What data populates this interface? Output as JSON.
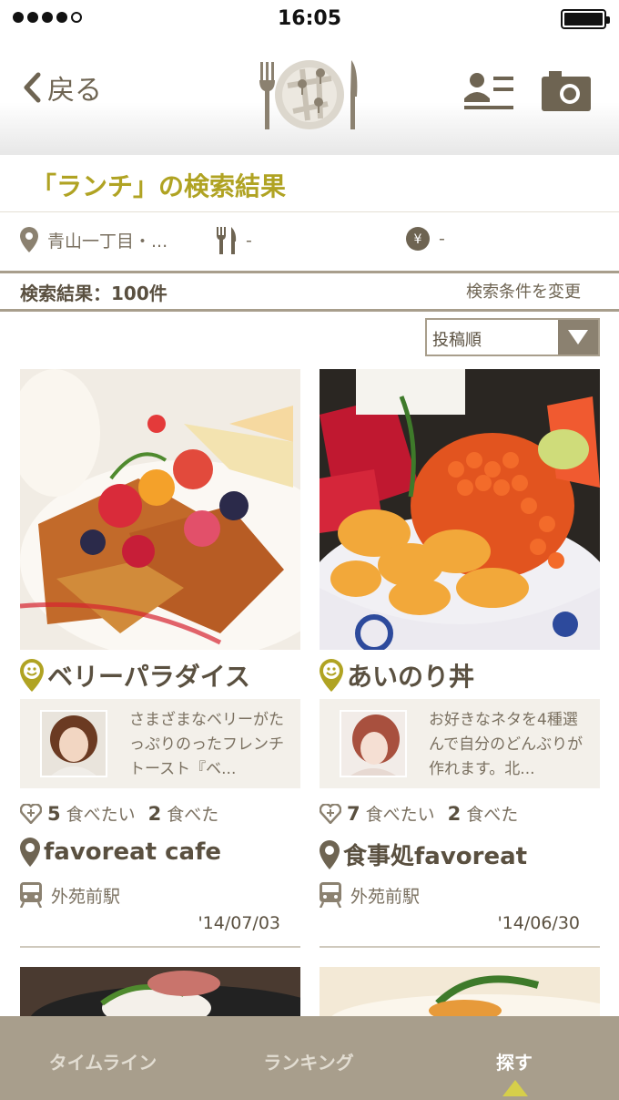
{
  "status_bar": {
    "time": "16:05"
  },
  "nav": {
    "back_label": "戻る"
  },
  "search": {
    "title": "「ランチ」の検索結果"
  },
  "filters": {
    "area": "青山一丁目・...",
    "genre": "-",
    "price": "-"
  },
  "results": {
    "count_label": "検索結果：100件",
    "change_label": "検索条件を変更"
  },
  "sort": {
    "selected": "投稿順"
  },
  "posts": [
    {
      "dish": "ベリーパラダイス",
      "comment": "さまざまなベリーがたっぷりのったフレンチトースト『ベ...",
      "want_count": "5",
      "want_label": "食べたい",
      "ate_count": "2",
      "ate_label": "食べた",
      "shop": "favoreat cafe",
      "station": "外苑前駅",
      "date": "'14/07/03"
    },
    {
      "dish": "あいのり丼",
      "comment": "お好きなネタを4種選んで自分のどんぶりが作れます。北...",
      "want_count": "7",
      "want_label": "食べたい",
      "ate_count": "2",
      "ate_label": "食べた",
      "shop": "食事処favoreat",
      "station": "外苑前駅",
      "date": "'14/06/30"
    }
  ],
  "tabs": [
    {
      "label": "タイムライン"
    },
    {
      "label": "ランキング"
    },
    {
      "label": "探す"
    }
  ],
  "colors": {
    "accent": "#b0a323",
    "brand": "#a89e8c",
    "text": "#5a5040"
  }
}
